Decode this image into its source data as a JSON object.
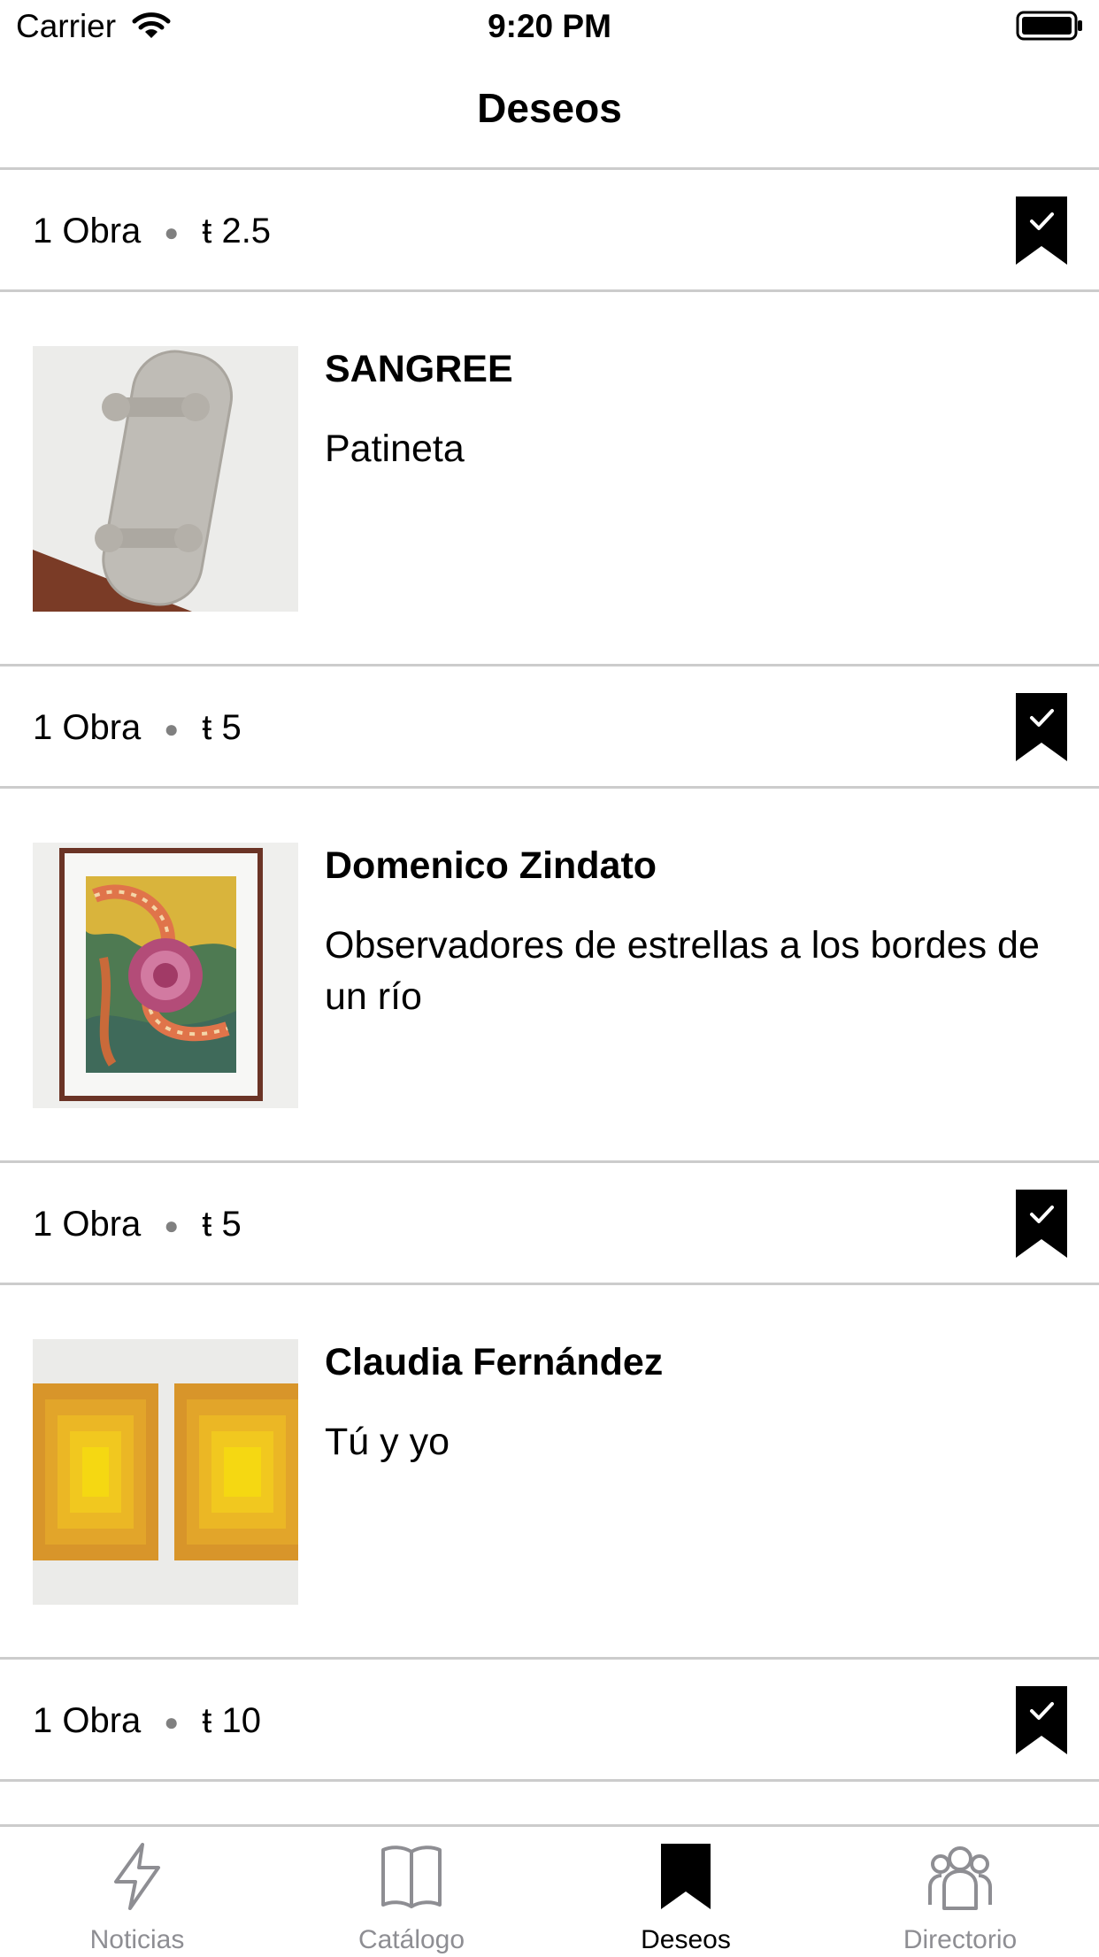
{
  "status_bar": {
    "carrier": "Carrier",
    "time": "9:20 PM"
  },
  "nav": {
    "title": "Deseos"
  },
  "entries": [
    {
      "count": "1 Obra",
      "price": "ŧ 2.5",
      "artist": "SANGREE",
      "title": "Patineta",
      "thumb_icon": "skateboard-artwork"
    },
    {
      "count": "1 Obra",
      "price": "ŧ 5",
      "artist": "Domenico Zindato",
      "title": "Observadores de estrellas a los bordes de un río",
      "thumb_icon": "framed-painting-artwork"
    },
    {
      "count": "1 Obra",
      "price": "ŧ 5",
      "artist": "Claudia Fernández",
      "title": "Tú y yo",
      "thumb_icon": "yellow-panels-artwork"
    },
    {
      "count": "1 Obra",
      "price": "ŧ 10"
    }
  ],
  "tabs": [
    {
      "label": "Noticias",
      "icon": "lightning-icon",
      "active": false
    },
    {
      "label": "Catálogo",
      "icon": "book-icon",
      "active": false
    },
    {
      "label": "Deseos",
      "icon": "bookmark-icon",
      "active": true
    },
    {
      "label": "Directorio",
      "icon": "people-icon",
      "active": false
    }
  ],
  "colors": {
    "separator": "#cccccc",
    "inactive_tab": "#8e8e93",
    "active_tab": "#000000"
  }
}
